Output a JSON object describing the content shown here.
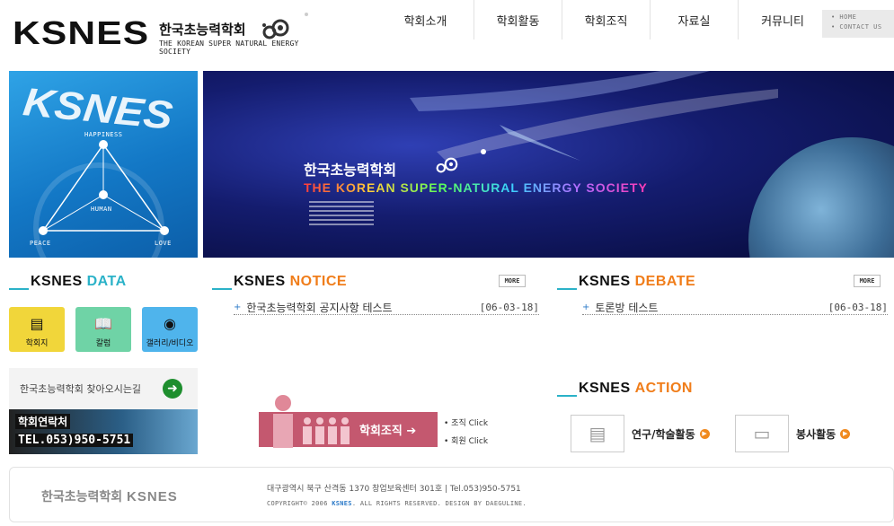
{
  "header": {
    "logo_main": "KSNES",
    "logo_kr": "한국초능력학회",
    "logo_en": "THE KOREAN SUPER NATURAL ENERGY SOCIETY",
    "nav": [
      "학회소개",
      "학회활동",
      "학회조직",
      "자료실",
      "커뮤니티"
    ],
    "util": [
      "• HOME",
      "• CONTACT US"
    ]
  },
  "banner_left": {
    "logo": "KSNES",
    "labels": {
      "top": "HAPPINESS",
      "middle": "HUMAN",
      "left": "PEACE",
      "right": "LOVE"
    }
  },
  "banner_right": {
    "title_kr": "한국초능력학회",
    "title_en": "THE KOREAN SUPER-NATURAL ENERGY SOCIETY"
  },
  "data_section": {
    "title_k": "KSNES",
    "title_c": "DATA",
    "buttons": [
      {
        "label": "학회지",
        "icon": "book-icon",
        "color": "#f1d63a"
      },
      {
        "label": "칼럼",
        "icon": "open-book-icon",
        "color": "#6fd3a6"
      },
      {
        "label": "갤러리/비디오",
        "icon": "eye-icon",
        "color": "#4fb4ec"
      }
    ]
  },
  "notice_section": {
    "title_k": "KSNES",
    "title_c": "NOTICE",
    "more": "MORE",
    "items": [
      {
        "title": "한국초능력학회 공지사항 테스트",
        "date": "[06-03-18]"
      }
    ]
  },
  "debate_section": {
    "title_k": "KSNES",
    "title_c": "DEBATE",
    "more": "MORE",
    "items": [
      {
        "title": "토론방 테스트",
        "date": "[06-03-18]"
      }
    ]
  },
  "action_section": {
    "title_k": "KSNES",
    "title_c": "ACTION",
    "buttons": [
      {
        "label": "연구/학술활동",
        "icon": "document-icon"
      },
      {
        "label": "봉사활동",
        "icon": "monitor-icon"
      }
    ]
  },
  "find_box": {
    "text": "한국초능력학회 찾아오시는길"
  },
  "contact": {
    "label": "학회연락처",
    "tel": "TEL.053)950-5751"
  },
  "org": {
    "text": "학회조직",
    "links": [
      "• 조직 Click",
      "• 회원 Click"
    ]
  },
  "footer": {
    "logo_kr": "한국초능력학회",
    "logo_en": "KSNES",
    "address": "대구광역시 북구 산격동 1370 창업보육센터 301호   |   Tel.053)950-5751",
    "copy_pre": "COPYRIGHT© 2006 ",
    "copy_hl": "KSNES",
    "copy_post": ". ALL RIGHTS RESERVED. DESIGN BY DAEGULINE."
  },
  "colors": {
    "accent_teal": "#2bb2c8",
    "accent_orange": "#f07d1a",
    "org_pink": "#c4586f"
  }
}
